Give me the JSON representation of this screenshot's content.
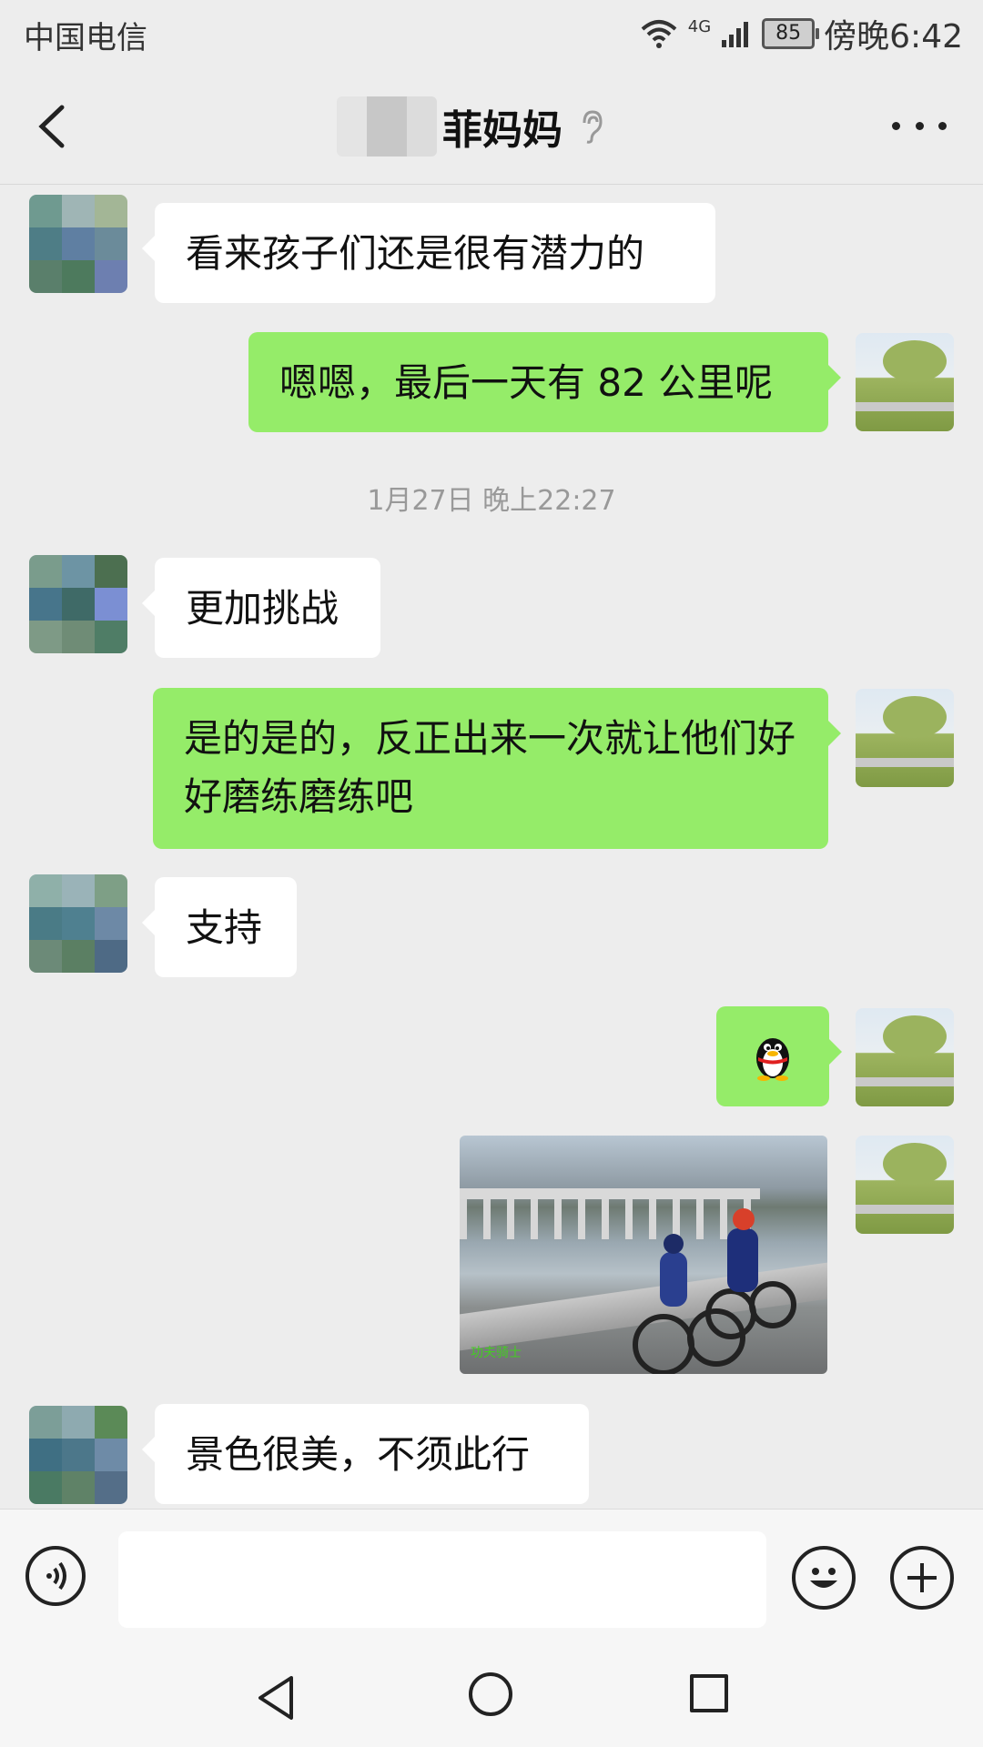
{
  "status_bar": {
    "carrier": "中国电信",
    "network": "4G",
    "battery": "85",
    "time": "傍晚6:42"
  },
  "header": {
    "title": "菲妈妈"
  },
  "messages": [
    {
      "direction": "in",
      "text": "看来孩子们还是很有潜力的"
    },
    {
      "direction": "out",
      "text": "嗯嗯，最后一天有 82 公里呢"
    },
    {
      "type": "timestamp",
      "text": "1月27日 晚上22:27"
    },
    {
      "direction": "in",
      "text": "更加挑战"
    },
    {
      "direction": "out",
      "text": "是的是的，反正出来一次就让他们好好磨练磨练吧"
    },
    {
      "direction": "in",
      "text": "支持"
    },
    {
      "direction": "out",
      "type": "emoji",
      "icon": "qq-penguin-icon"
    },
    {
      "direction": "out",
      "type": "image",
      "watermark": "功夫骑士"
    },
    {
      "direction": "in",
      "text": "景色很美，不须此行"
    }
  ],
  "colors": {
    "out_bubble": "#95ec69",
    "in_bubble": "#ffffff",
    "background": "#ededed"
  }
}
